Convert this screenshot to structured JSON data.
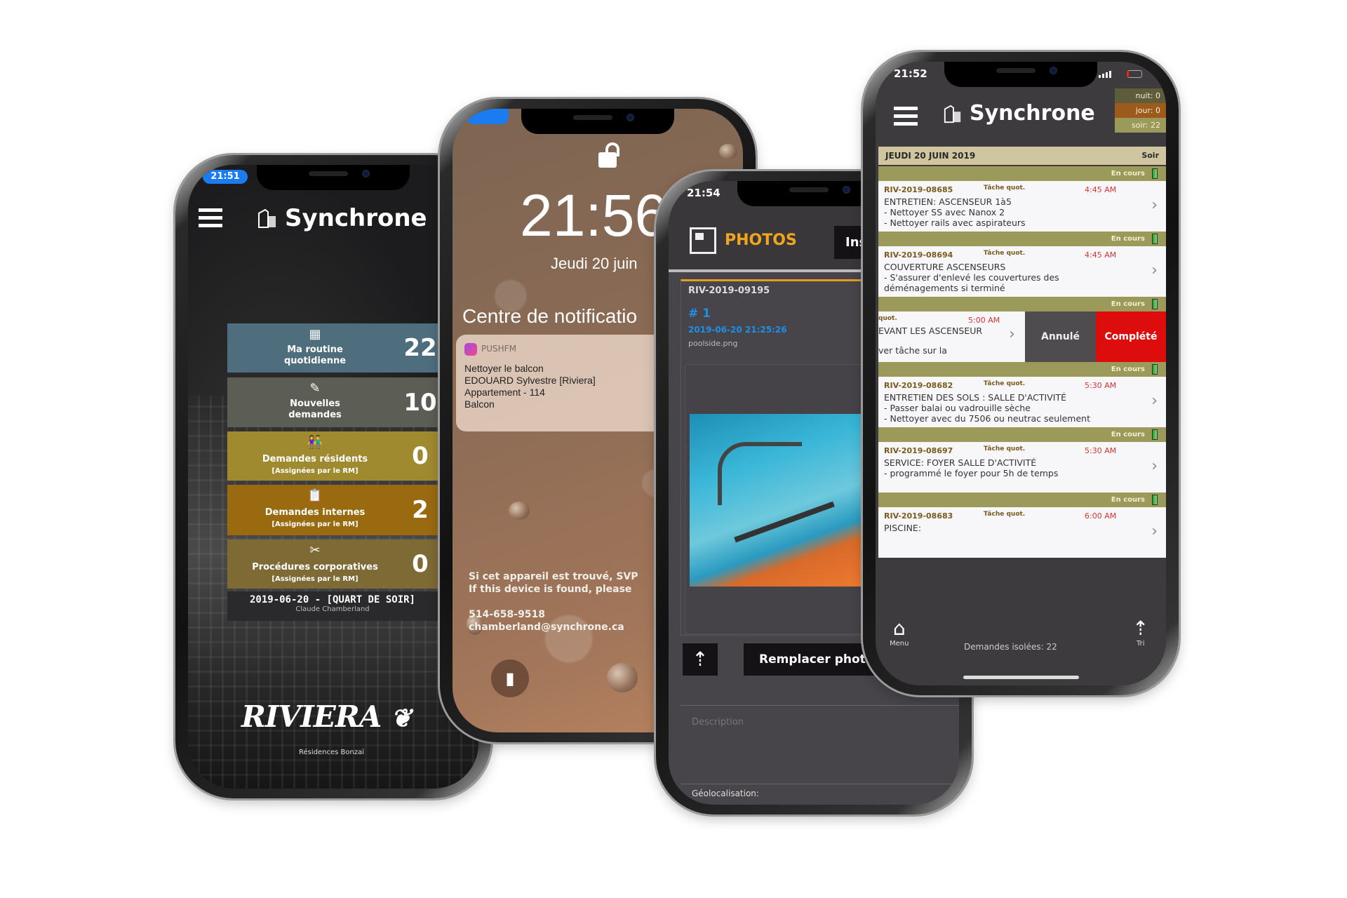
{
  "phone_home": {
    "status_time": "21:51",
    "brand": "Synchrone",
    "tiles": [
      {
        "label": "Ma routine",
        "sub": "quotidienne",
        "count": "22",
        "icon": "calendar-icon",
        "color": "#4f6e7d"
      },
      {
        "label": "Nouvelles",
        "sub": "demandes",
        "count": "10",
        "icon": "notepad-icon",
        "color": "#5c5e55"
      },
      {
        "label": "Demandes résidents",
        "sub": "[Assignées par le RM]",
        "count": "0",
        "icon": "residents-icon",
        "color": "#a08a30"
      },
      {
        "label": "Demandes internes",
        "sub": "[Assignées par le RM]",
        "count": "2",
        "icon": "clipboard-icon",
        "color": "#9a6a10"
      },
      {
        "label": "Procédures corporatives",
        "sub": "[Assignées par le RM]",
        "count": "0",
        "icon": "tools-icon",
        "color": "#7d6a35"
      }
    ],
    "shift": "2019-06-20 - [QUART DE SOIR]",
    "user": "Claude Chamberland",
    "logo": "RIVIERA",
    "logo_sub": "Résidences Bonzaï"
  },
  "phone_lock": {
    "time": "21:56",
    "date": "Jeudi 20 juin",
    "notif_center": "Centre de notificatio",
    "notification": {
      "app": "PUSHFM",
      "lines": [
        "Nettoyer le balcon",
        "EDOUARD Sylvestre [Riviera]",
        "Appartement - 114",
        "Balcon"
      ]
    },
    "found_fr": "Si cet appareil est trouvé, SVP",
    "found_en": "If this device is found, please",
    "phone": "514-658-9518",
    "email": "chamberland@synchrone.ca"
  },
  "phone_photos": {
    "status_time": "21:54",
    "title": "PHOTOS",
    "tab_partial": "Ins",
    "request_id": "RIV-2019-09195",
    "photo_num": "# 1",
    "photo_date": "2019-06-20 21:25:26",
    "filename": "poolside.png",
    "replace_label": "Remplacer photo",
    "description_placeholder": "Description",
    "geoloc_label": "Géolocalisation:"
  },
  "phone_tasks": {
    "status_time": "21:52",
    "brand": "Synchrone",
    "counters": [
      {
        "label": "nuit: 0",
        "color": "#5e5c3a"
      },
      {
        "label": "jour: 0",
        "color": "#9c5a1c"
      },
      {
        "label": "soir: 22",
        "color": "#9c9a5a"
      }
    ],
    "date": "JEUDI 20 JUIN 2019",
    "period": "Soir",
    "status_label": "En cours",
    "kind": "Tâche quot.",
    "items": [
      {
        "id": "RIV-2019-08685",
        "time": "4:45 AM",
        "lines": [
          "ENTRETIEN: ASCENSEUR  1à5",
          "- Nettoyer SS avec Nanox 2",
          "- Nettoyer rails avec aspirateurs"
        ]
      },
      {
        "id": "RIV-2019-08694",
        "time": "4:45 AM",
        "lines": [
          "COUVERTURE ASCENSEURS",
          "- S'assurer d'enlevé les couvertures des",
          "déménagements si terminé"
        ]
      },
      {
        "kind_partial": "quot.",
        "time": "5:00 AM",
        "lines": [
          "EVANT LES ASCENSEUR",
          "",
          "ver tâche sur la"
        ]
      },
      {
        "id": "RIV-2019-08682",
        "time": "5:30 AM",
        "lines": [
          "ENTRETIEN DES SOLS : SALLE D'ACTIVITÉ",
          "- Passer balai ou vadrouille sèche",
          "- Nettoyer avec du 7506 ou neutrac seulement"
        ]
      },
      {
        "id": "RIV-2019-08697",
        "time": "5:30 AM",
        "lines": [
          "SERVICE: FOYER SALLE D'ACTIVITÉ",
          "- programmé le foyer pour 5h de temps"
        ]
      },
      {
        "id": "RIV-2019-08683",
        "time": "6:00 AM",
        "lines": [
          "PISCINE:"
        ]
      }
    ],
    "cancel_label": "Annulé",
    "complete_label": "Complété",
    "menu_label": "Menu",
    "isolated": "Demandes isolées: 22",
    "sort_label": "Tri"
  }
}
